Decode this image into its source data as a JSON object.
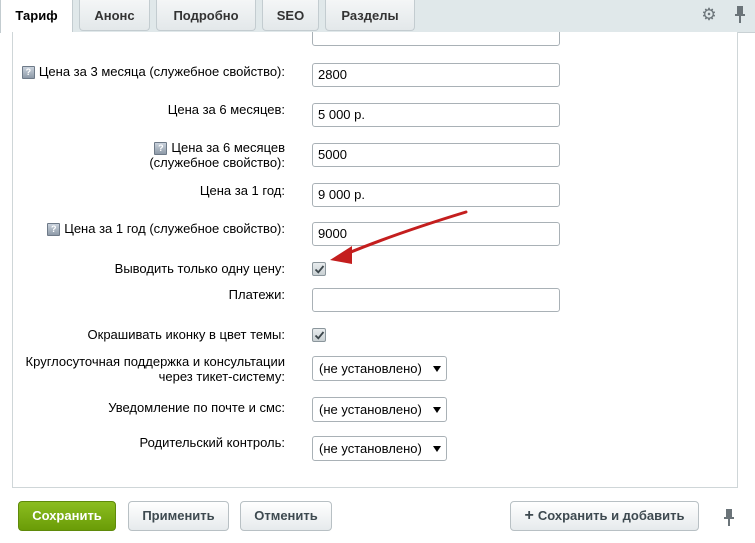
{
  "tabs": [
    {
      "label": "Тариф",
      "active": true
    },
    {
      "label": "Анонс"
    },
    {
      "label": "Подробно"
    },
    {
      "label": "SEO"
    },
    {
      "label": "Разделы"
    }
  ],
  "icons": {
    "settings": "gear-icon",
    "pin": "pin-icon",
    "hint": "hint-icon",
    "plus": "plus-icon",
    "annotation": "red-arrow"
  },
  "hint_glyph": "?",
  "fields": {
    "price_3m_service": {
      "label": "Цена за 3 месяца (служебное свойство):",
      "value": "2800"
    },
    "price_6m": {
      "label": "Цена за 6 месяцев:",
      "value": "5 000 р."
    },
    "price_6m_service": {
      "label": "Цена за 6 месяцев (служебное свойство):",
      "value": "5000"
    },
    "price_1y": {
      "label": "Цена за 1 год:",
      "value": "9 000 р."
    },
    "price_1y_service": {
      "label": "Цена за 1 год (служебное свойство):",
      "value": "9000"
    },
    "single_price": {
      "label": "Выводить только одну цену:",
      "checked": true
    },
    "payments": {
      "label": "Платежи:",
      "value": ""
    },
    "icon_theme_color": {
      "label": "Окрашивать иконку в цвет темы:",
      "checked": true
    },
    "support_24h": {
      "label": "Круглосуточная поддержка и консультации через тикет-систему:",
      "value": "(не установлено)"
    },
    "email_sms": {
      "label": "Уведомление по почте и смс:",
      "value": "(не установлено)"
    },
    "parental": {
      "label": "Родительский контроль:",
      "value": "(не установлено)"
    }
  },
  "buttons": {
    "save": "Сохранить",
    "apply": "Применить",
    "cancel": "Отменить",
    "save_add": "Сохранить и добавить"
  },
  "colors": {
    "save_button": "#76a814",
    "annotation_arrow": "#c41e1e"
  }
}
